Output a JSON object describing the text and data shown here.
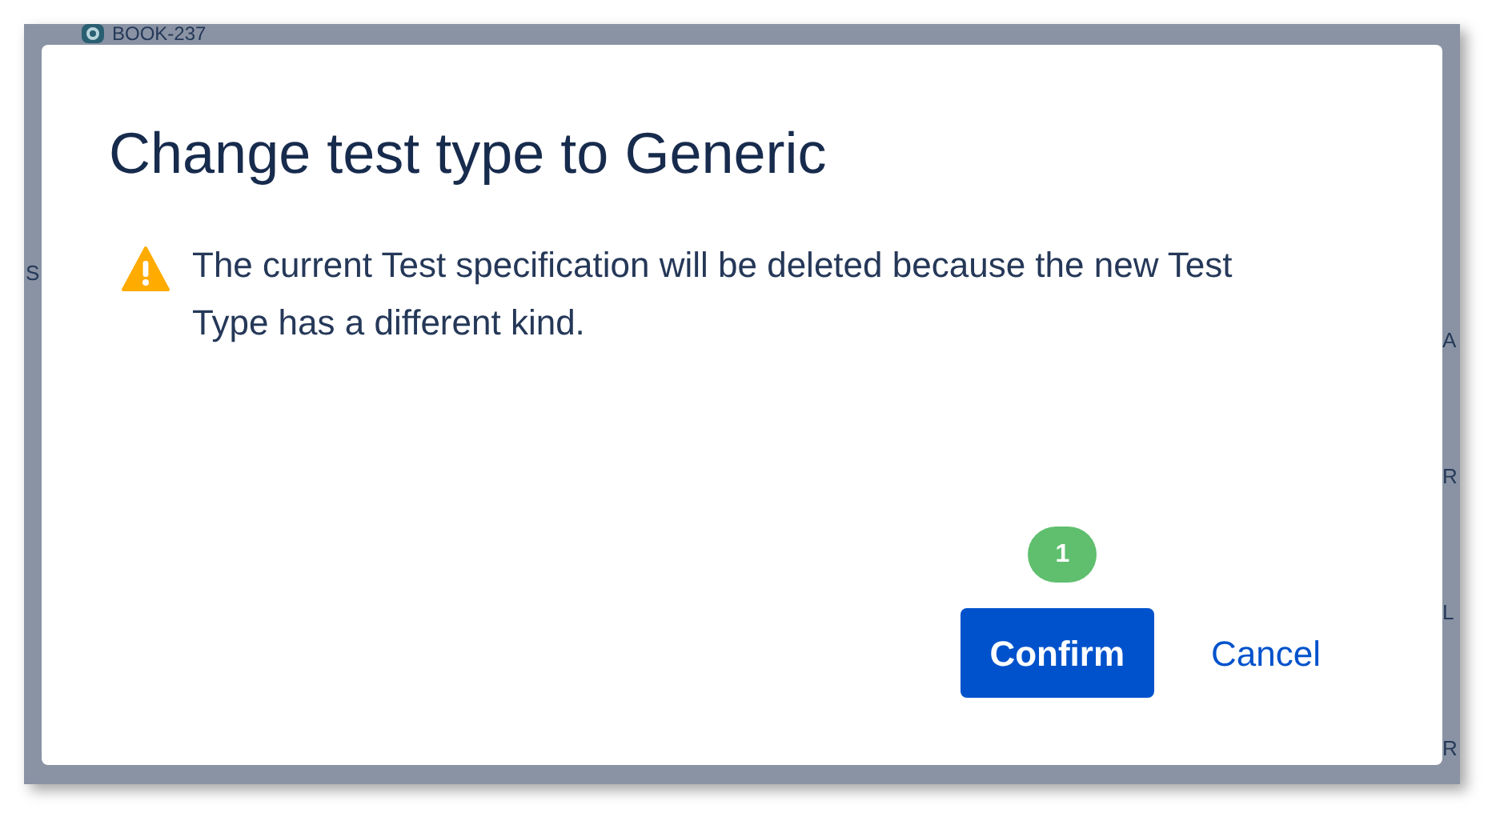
{
  "background": {
    "issue_key": "BOOK-237",
    "left_fragment": "S",
    "right_fragments": [
      "A",
      "R",
      "L",
      "R"
    ]
  },
  "dialog": {
    "title": "Change test type to Generic",
    "warning": "The current Test specification will be deleted because the new Test Type has a different kind.",
    "step_badge": "1",
    "buttons": [
      {
        "label": "Confirm",
        "kind": "primary"
      },
      {
        "label": "Cancel",
        "kind": "link"
      }
    ]
  }
}
